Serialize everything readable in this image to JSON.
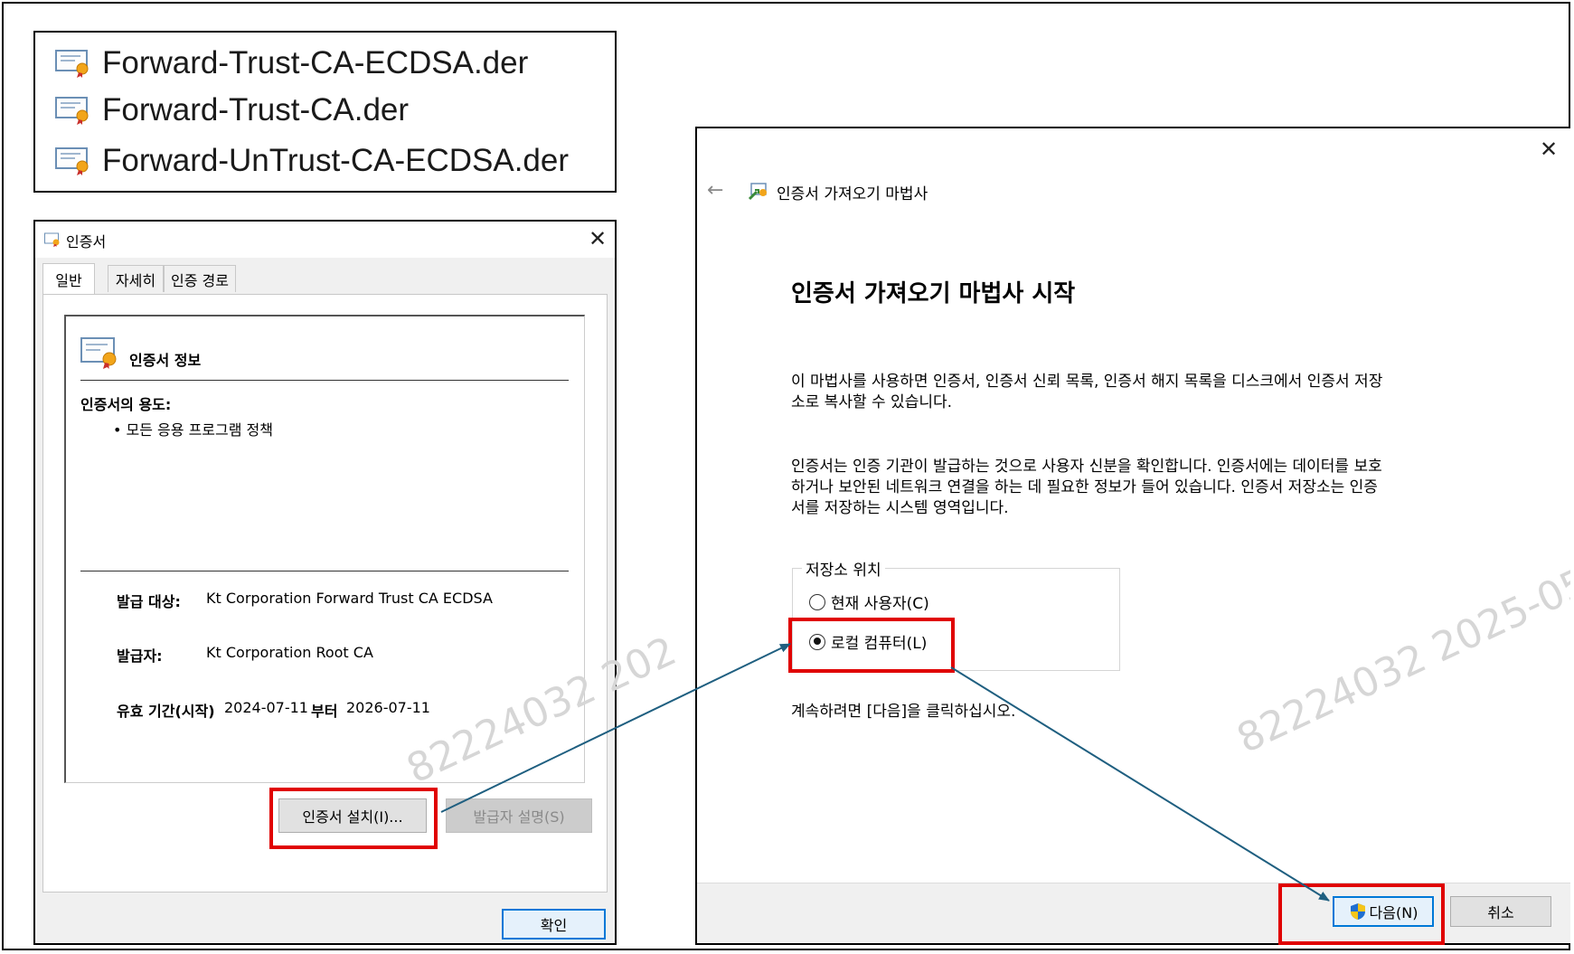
{
  "files": [
    {
      "name": "Forward-Trust-CA-ECDSA.der",
      "icon": "certificate-file-icon"
    },
    {
      "name": "Forward-Trust-CA.der",
      "icon": "certificate-file-icon"
    },
    {
      "name": "Forward-UnTrust-CA-ECDSA.der",
      "icon": "certificate-file-icon"
    }
  ],
  "cert_dialog": {
    "title": "인증서",
    "close": "✕",
    "tabs": [
      "일반",
      "자세히",
      "인증 경로"
    ],
    "active_tab": "일반",
    "info_title": "인증서 정보",
    "purpose_label": "인증서의 용도:",
    "purpose_item": "• 모든 응용 프로그램 정책",
    "issued_to_label": "발급 대상:",
    "issued_to_value": "Kt Corporation Forward Trust CA ECDSA",
    "issued_by_label": "발급자:",
    "issued_by_value": "Kt Corporation Root CA",
    "valid_label": "유효 기간(시작)",
    "valid_from": "2024-07-11",
    "valid_to_label": "부터",
    "valid_to": "2026-07-11",
    "install_button": "인증서 설치(I)...",
    "issuer_statement_button": "발급자 설명(S)",
    "ok_button": "확인",
    "watermark": "82224032  202"
  },
  "wizard": {
    "close": "✕",
    "back": "←",
    "title": "인증서 가져오기 마법사",
    "heading": "인증서 가져오기 마법사 시작",
    "para1_line1": "이 마법사를 사용하면 인증서, 인증서 신뢰 목록, 인증서 해지 목록을 디스크에서 인증서 저장",
    "para1_line2": "소로 복사할 수 있습니다.",
    "para2_line1": "인증서는 인증 기관이 발급하는 것으로 사용자 신분을 확인합니다. 인증서에는 데이터를 보호",
    "para2_line2": "하거나 보안된 네트워크 연결을 하는 데 필요한 정보가 들어 있습니다. 인증서 저장소는 인증",
    "para2_line3": "서를 저장하는 시스템 영역입니다.",
    "store_location_label": "저장소 위치",
    "option_current_user": "현재 사용자(C)",
    "option_local_machine": "로컬 컴퓨터(L)",
    "selected_option": "local_machine",
    "continue_text": "계속하려면 [다음]을 클릭하십시오.",
    "next_button": "다음(N)",
    "cancel_button": "취소",
    "watermark": "82224032  2025-05-"
  },
  "colors": {
    "highlight_box": "#e00000",
    "arrow": "#1f5f80",
    "default_button_border": "#0078d7"
  }
}
